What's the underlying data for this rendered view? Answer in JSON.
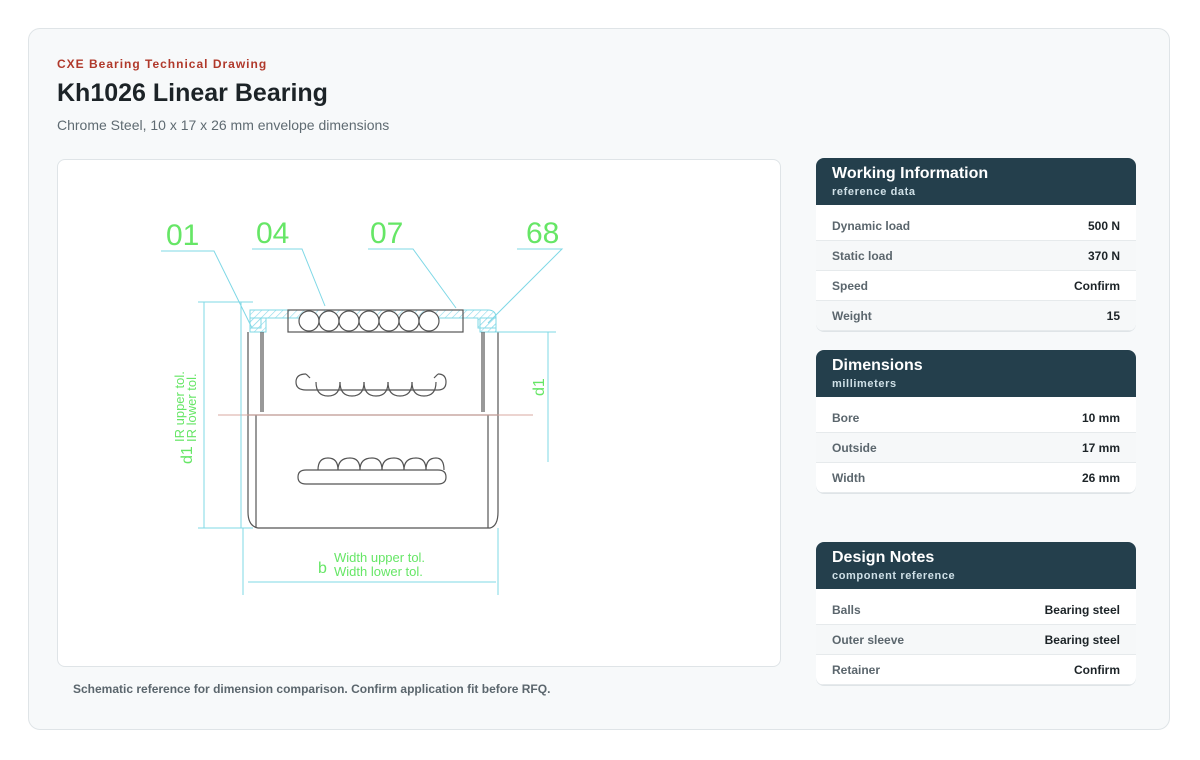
{
  "header": {
    "eyebrow": "CXE Bearing Technical Drawing",
    "title": "Kh1026 Linear Bearing",
    "subtitle": "Chrome Steel, 10 x 17 x 26 mm envelope dimensions"
  },
  "drawing": {
    "callouts": [
      "01",
      "04",
      "07",
      "68"
    ],
    "dim_d1_left": "d1",
    "tol_upper": "IR upper tol.",
    "tol_lower": "IR lower tol.",
    "dim_d1_right": "d1",
    "dim_b": "b",
    "width_upper": "Width upper tol.",
    "width_lower": "Width lower tol.",
    "colors": {
      "dimension": "#66e666",
      "leader": "#7fd8e6",
      "hatch": "#8fd9ea",
      "part": "#555555",
      "axis": "#d9a8a0"
    }
  },
  "caption": "Schematic reference for dimension comparison. Confirm application fit before RFQ.",
  "panels": [
    {
      "title": "Working Information",
      "subtitle": "reference data",
      "rows": [
        {
          "label": "Dynamic load",
          "value": "500 N"
        },
        {
          "label": "Static load",
          "value": "370 N"
        },
        {
          "label": "Speed",
          "value": "Confirm"
        },
        {
          "label": "Weight",
          "value": "15"
        }
      ]
    },
    {
      "title": "Dimensions",
      "subtitle": "millimeters",
      "rows": [
        {
          "label": "Bore",
          "value": "10 mm"
        },
        {
          "label": "Outside",
          "value": "17 mm"
        },
        {
          "label": "Width",
          "value": "26 mm"
        }
      ]
    },
    {
      "title": "Design Notes",
      "subtitle": "component reference",
      "rows": [
        {
          "label": "Balls",
          "value": "Bearing steel"
        },
        {
          "label": "Outer sleeve",
          "value": "Bearing steel"
        },
        {
          "label": "Retainer",
          "value": "Confirm"
        }
      ]
    }
  ]
}
